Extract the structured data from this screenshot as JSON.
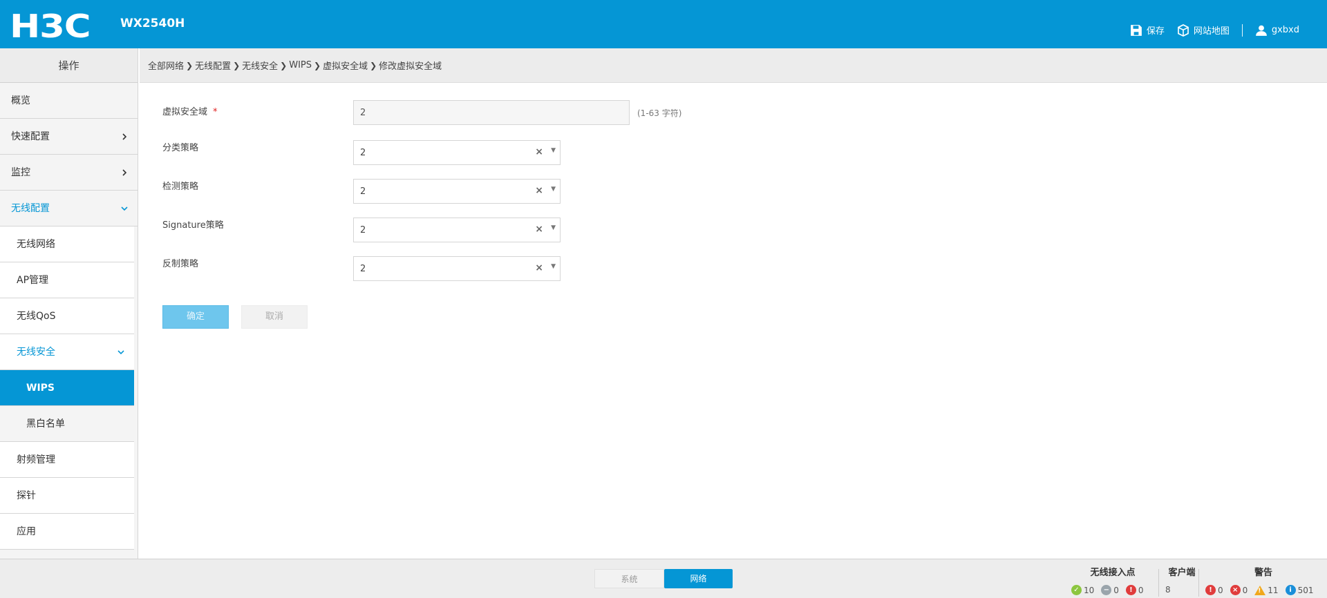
{
  "header": {
    "logo": "H3C",
    "model": "WX2540H",
    "save_label": "保存",
    "sitemap_label": "网站地图",
    "user_label": "gxbxd"
  },
  "sidebar": {
    "title": "操作",
    "items": [
      {
        "label": "概览"
      },
      {
        "label": "快速配置"
      },
      {
        "label": "监控"
      },
      {
        "label": "无线配置"
      }
    ],
    "wireless_sub": [
      {
        "label": "无线网络"
      },
      {
        "label": "AP管理"
      },
      {
        "label": "无线QoS"
      },
      {
        "label": "无线安全"
      }
    ],
    "security_sub": [
      {
        "label": "WIPS"
      },
      {
        "label": "黑白名单"
      }
    ],
    "wireless_sub_after": [
      {
        "label": "射频管理"
      },
      {
        "label": "探针"
      },
      {
        "label": "应用"
      }
    ]
  },
  "breadcrumb": [
    "全部网络",
    "无线配置",
    "无线安全",
    "WIPS",
    "虚拟安全域",
    "修改虚拟安全域"
  ],
  "form": {
    "vsd_label": "虚拟安全域",
    "vsd_required": "*",
    "vsd_value": "2",
    "vsd_hint": "(1-63 字符)",
    "classify_label": "分类策略",
    "classify_value": "2",
    "detect_label": "检测策略",
    "detect_value": "2",
    "signature_label": "Signature策略",
    "signature_value": "2",
    "counter_label": "反制策略",
    "counter_value": "2",
    "ok_label": "确定",
    "cancel_label": "取消"
  },
  "footer": {
    "mode_system": "系统",
    "mode_network": "网络",
    "ap_title": "无线接入点",
    "ap_ok": "10",
    "ap_offline": "0",
    "ap_fault": "0",
    "client_title": "客户端",
    "client_count": "8",
    "alarm_title": "警告",
    "alarm_critical": "0",
    "alarm_major": "0",
    "alarm_warning": "11",
    "alarm_info": "501"
  },
  "colors": {
    "brand": "#0596d5",
    "ok": "#8cc63f",
    "offline": "#9aa4ab",
    "fault": "#e03c3c",
    "warning": "#f0a81c",
    "info": "#1a8fd9"
  }
}
